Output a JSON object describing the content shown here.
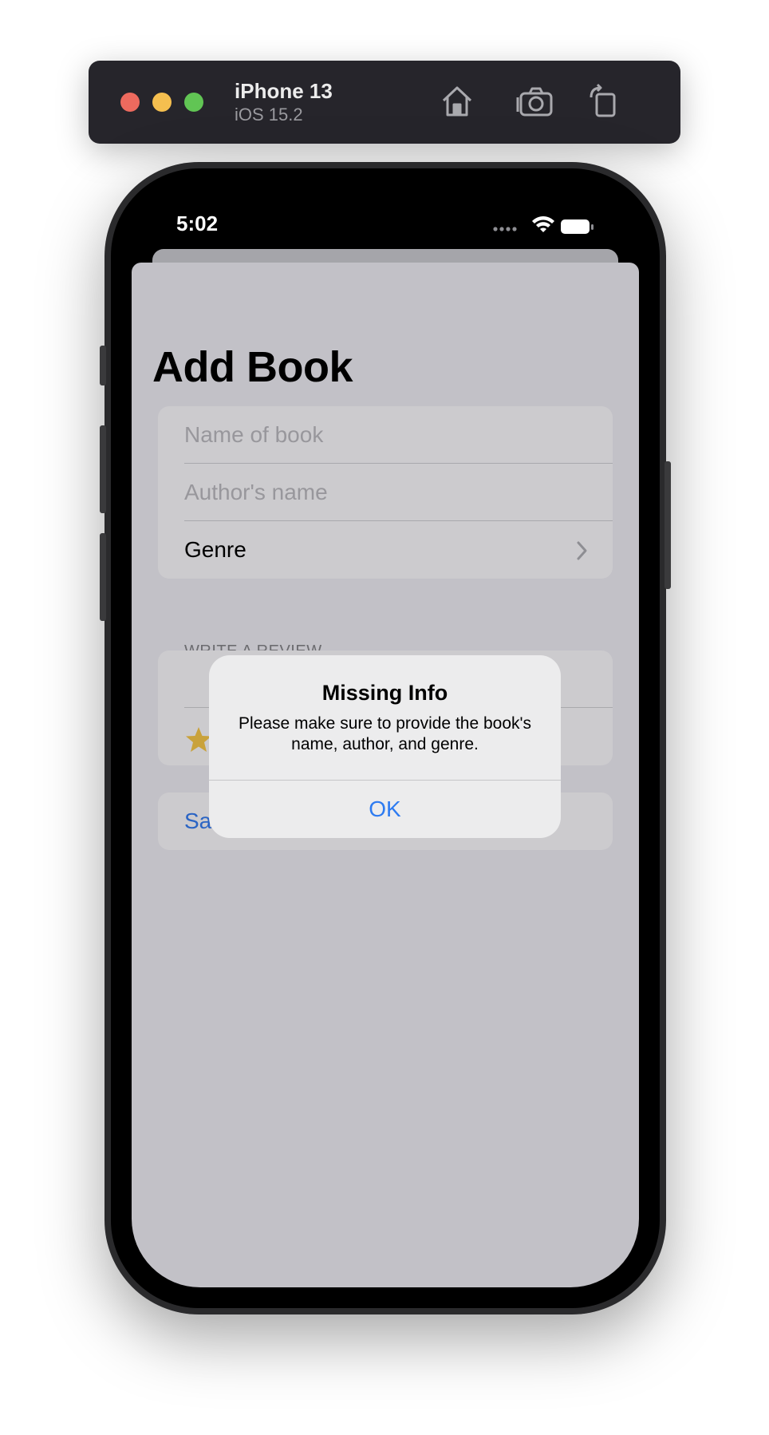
{
  "simulator": {
    "device_name": "iPhone 13",
    "os_version": "iOS 15.2",
    "toolbar_icons": [
      "home-icon",
      "camera-icon",
      "rotate-icon"
    ]
  },
  "status_bar": {
    "time": "5:02",
    "icons": [
      "cellular-dots-icon",
      "wifi-icon",
      "battery-icon"
    ]
  },
  "page": {
    "title": "Add Book",
    "book_form": {
      "name_placeholder": "Name of book",
      "author_placeholder": "Author's name",
      "genre_label": "Genre"
    },
    "review_section": {
      "header": "WRITE A REVIEW",
      "rating_icon": "star-icon"
    },
    "save_label": "Save"
  },
  "alert": {
    "title": "Missing Info",
    "message": "Please make sure to provide the book's name, author, and genre.",
    "ok_label": "OK"
  },
  "colors": {
    "accent_blue": "#2d7bf1",
    "star_yellow": "#c9a23b",
    "sheet_dimmed": "#c2c1c7"
  }
}
